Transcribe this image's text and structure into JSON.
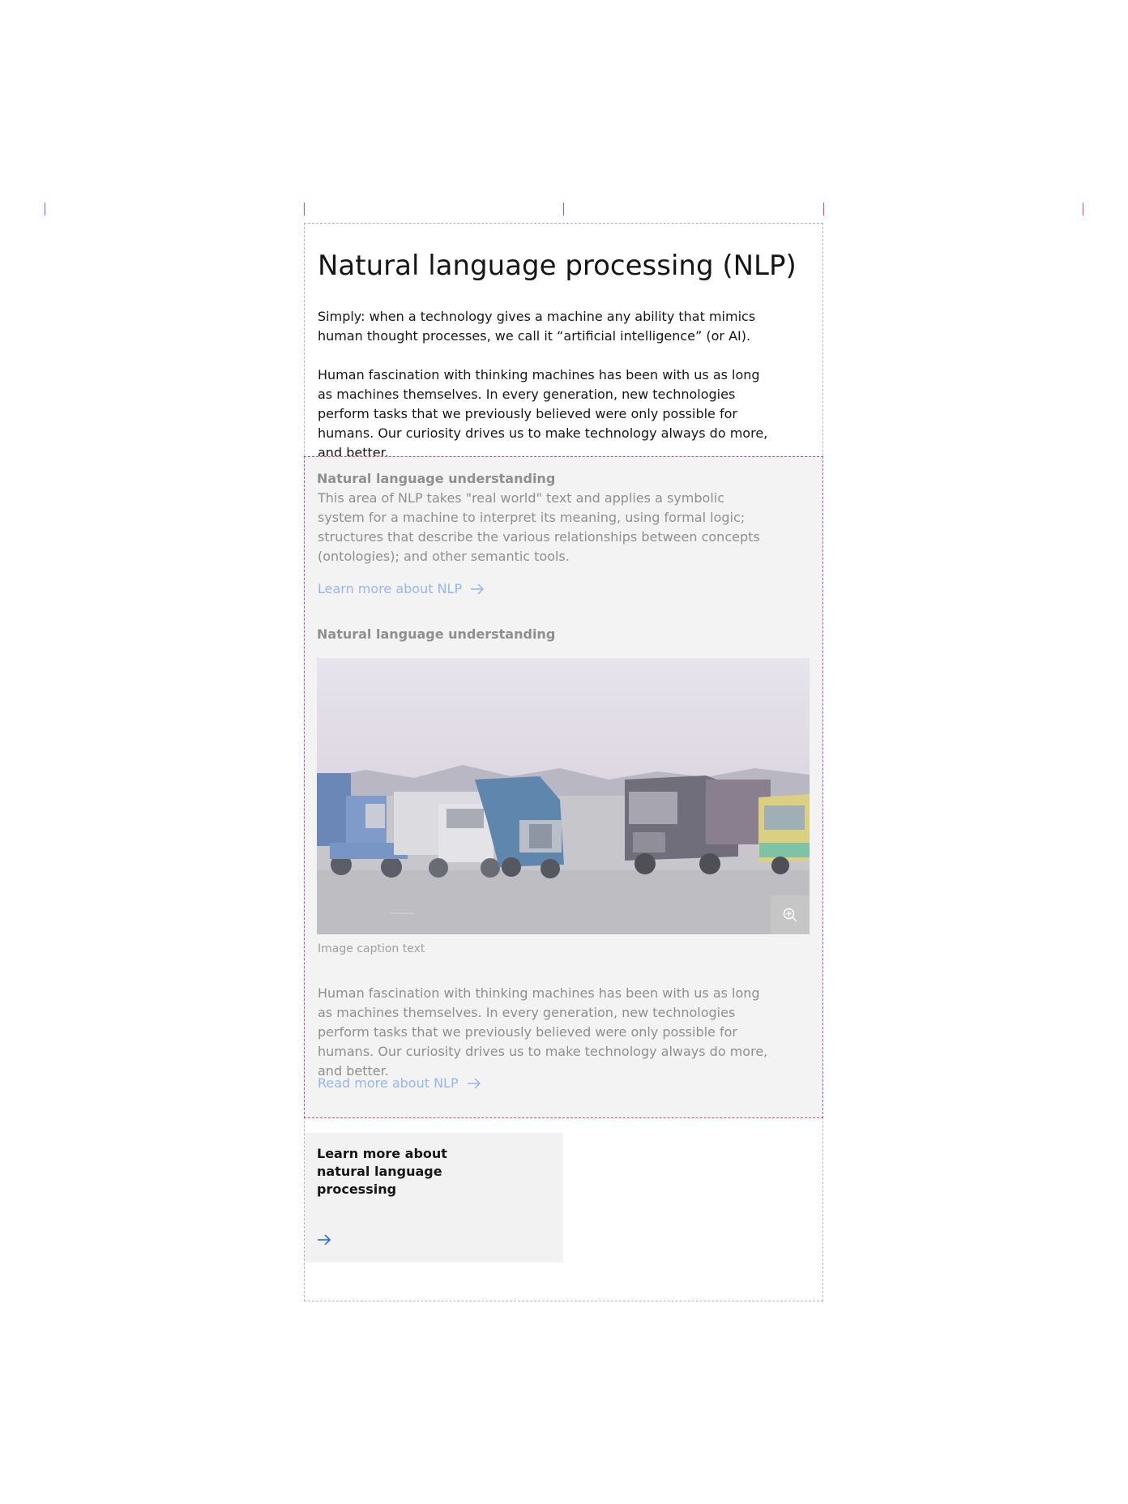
{
  "page": {
    "title": "Natural language processing (NLP)",
    "intro_paragraphs": [
      "Simply: when a technology gives a machine any ability that mimics human thought processes, we call it “artificial intelligence” (or AI).",
      "Human fascination with thinking machines has been with us as long as machines themselves. In every generation, new technologies perform tasks that we previously believed were only possible for humans. Our curiosity drives us to make technology always do more, and better."
    ]
  },
  "panel": {
    "section1": {
      "heading": "Natural language understanding",
      "text": "This area of NLP takes \"real world\" text and applies a symbolic system for a machine to interpret its meaning, using formal logic; structures that describe the various relationships between concepts (ontologies); and other semantic tools.",
      "link_label": "Learn more about NLP"
    },
    "section2": {
      "heading": "Natural language understanding",
      "image_caption": "Image caption text",
      "text": "Human fascination with thinking machines has been with us as long as machines themselves. In every generation, new technologies perform tasks that we previously believed were only possible for humans. Our curiosity drives us to make technology always do more, and better.",
      "link_label": "Read more about NLP"
    }
  },
  "card": {
    "title": "Learn more about natural language processing"
  },
  "icons": {
    "link_arrow": "arrow-right-icon",
    "zoom": "zoom-in-icon"
  },
  "colors": {
    "guide_tick": "#e0466f",
    "link_faded": "#93b6f2",
    "card_arrow": "#0f62fe",
    "panel_bg": "#f3f3f3"
  }
}
